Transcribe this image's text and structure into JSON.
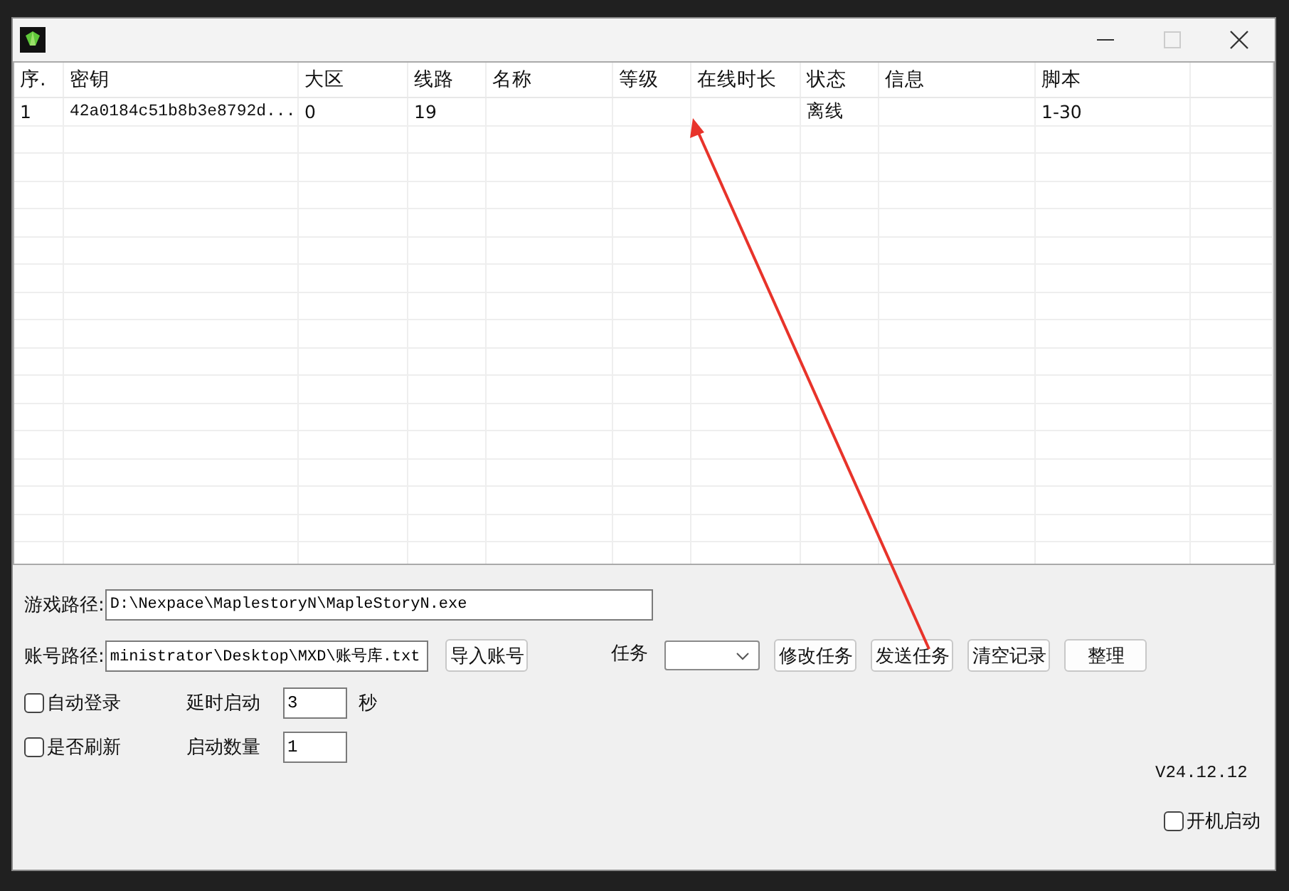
{
  "table": {
    "columns": [
      "序.",
      "密钥",
      "大区",
      "线路",
      "名称",
      "等级",
      "在线时长",
      "状态",
      "信息",
      "脚本"
    ],
    "rows": [
      {
        "cells": [
          "1",
          "42a0184c51b8b3e8792d...",
          "0",
          "19",
          "",
          "",
          "",
          "离线",
          "",
          "1-30"
        ]
      }
    ]
  },
  "game_path": {
    "label": "游戏路径:",
    "value": "D:\\Nexpace\\MaplestoryN\\MapleStoryN.exe"
  },
  "account_path": {
    "label": "账号路径:",
    "value": "ministrator\\Desktop\\MXD\\账号库.txt"
  },
  "import_button": "导入账号",
  "task": {
    "label": "任务"
  },
  "task_buttons": [
    "修改任务",
    "发送任务",
    "清空记录",
    "整理"
  ],
  "auto_login": {
    "label": "自动登录",
    "checked": false
  },
  "refresh": {
    "label": "是否刷新",
    "checked": false
  },
  "delay": {
    "label": "延时启动",
    "value": "3",
    "unit": "秒"
  },
  "launch_count": {
    "label": "启动数量",
    "value": "1"
  },
  "version": "V24.12.12",
  "startup": {
    "label": "开机启动",
    "checked": false
  }
}
